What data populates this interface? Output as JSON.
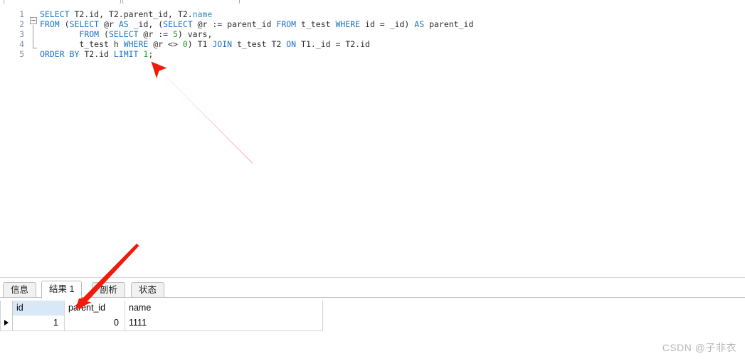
{
  "toolbar": {
    "widget_one_label": "",
    "widget_two_label": ""
  },
  "editor": {
    "language": "SQL",
    "line_numbers": [
      "1",
      "2",
      "3",
      "4",
      "5"
    ],
    "lines": [
      {
        "number": "1",
        "text": "SELECT T2.id, T2.parent_id, T2.name",
        "tokens": [
          {
            "t": "SELECT",
            "c": "kw"
          },
          {
            "t": " T2.id, T2.parent_id, T2.",
            "c": ""
          },
          {
            "t": "name",
            "c": "fn"
          }
        ]
      },
      {
        "number": "2",
        "text": "FROM (SELECT @r AS _id, (SELECT @r := parent_id FROM t_test WHERE id = _id) AS parent_id",
        "tokens": [
          {
            "t": "FROM",
            "c": "kw"
          },
          {
            "t": " (",
            "c": ""
          },
          {
            "t": "SELECT",
            "c": "kw"
          },
          {
            "t": " @r ",
            "c": ""
          },
          {
            "t": "AS",
            "c": "kw"
          },
          {
            "t": " _id, (",
            "c": ""
          },
          {
            "t": "SELECT",
            "c": "kw"
          },
          {
            "t": " @r := parent_id ",
            "c": ""
          },
          {
            "t": "FROM",
            "c": "kw"
          },
          {
            "t": " t_test ",
            "c": ""
          },
          {
            "t": "WHERE",
            "c": "kw"
          },
          {
            "t": " id = _id) ",
            "c": ""
          },
          {
            "t": "AS",
            "c": "kw"
          },
          {
            "t": " parent_id",
            "c": ""
          }
        ]
      },
      {
        "number": "3",
        "text": "        FROM (SELECT @r := 5) vars,",
        "tokens": [
          {
            "t": "        ",
            "c": ""
          },
          {
            "t": "FROM",
            "c": "kw"
          },
          {
            "t": " (",
            "c": ""
          },
          {
            "t": "SELECT",
            "c": "kw"
          },
          {
            "t": " @r := ",
            "c": ""
          },
          {
            "t": "5",
            "c": "num"
          },
          {
            "t": ") vars,",
            "c": ""
          }
        ]
      },
      {
        "number": "4",
        "text": "        t_test h WHERE @r <> 0) T1 JOIN t_test T2 ON T1._id = T2.id",
        "tokens": [
          {
            "t": "        t_test h ",
            "c": ""
          },
          {
            "t": "WHERE",
            "c": "kw"
          },
          {
            "t": " @r <> ",
            "c": ""
          },
          {
            "t": "0",
            "c": "num"
          },
          {
            "t": ") T1 ",
            "c": ""
          },
          {
            "t": "JOIN",
            "c": "kw"
          },
          {
            "t": " t_test T2 ",
            "c": ""
          },
          {
            "t": "ON",
            "c": "kw"
          },
          {
            "t": " T1._id = T2.id",
            "c": ""
          }
        ]
      },
      {
        "number": "5",
        "text": "ORDER BY T2.id LIMIT 1;",
        "tokens": [
          {
            "t": "ORDER BY",
            "c": "kw"
          },
          {
            "t": " T2.id ",
            "c": ""
          },
          {
            "t": "LIMIT",
            "c": "kw"
          },
          {
            "t": " ",
            "c": ""
          },
          {
            "t": "1",
            "c": "num"
          },
          {
            "t": ";",
            "c": ""
          }
        ]
      }
    ],
    "fold_marker": "collapse-minus"
  },
  "result_panel": {
    "tabs": [
      {
        "label": "信息",
        "active": false
      },
      {
        "label": "结果 1",
        "active": true
      },
      {
        "label": "剖析",
        "active": false
      },
      {
        "label": "状态",
        "active": false
      }
    ],
    "grid": {
      "columns": [
        "id",
        "parent_id",
        "name"
      ],
      "selected_column": "id",
      "rows": [
        {
          "marker": "current-row",
          "id": "1",
          "parent_id": "0",
          "name": "1111"
        }
      ]
    }
  },
  "annotations": {
    "arrow_one": {
      "label": "arrow-to-order-by-line",
      "color": "#f01a0d"
    },
    "arrow_two": {
      "label": "arrow-to-result-tab",
      "color": "#f01a0d"
    }
  },
  "watermark": {
    "text": "CSDN @子非衣",
    "color": "#b8b8b8"
  }
}
